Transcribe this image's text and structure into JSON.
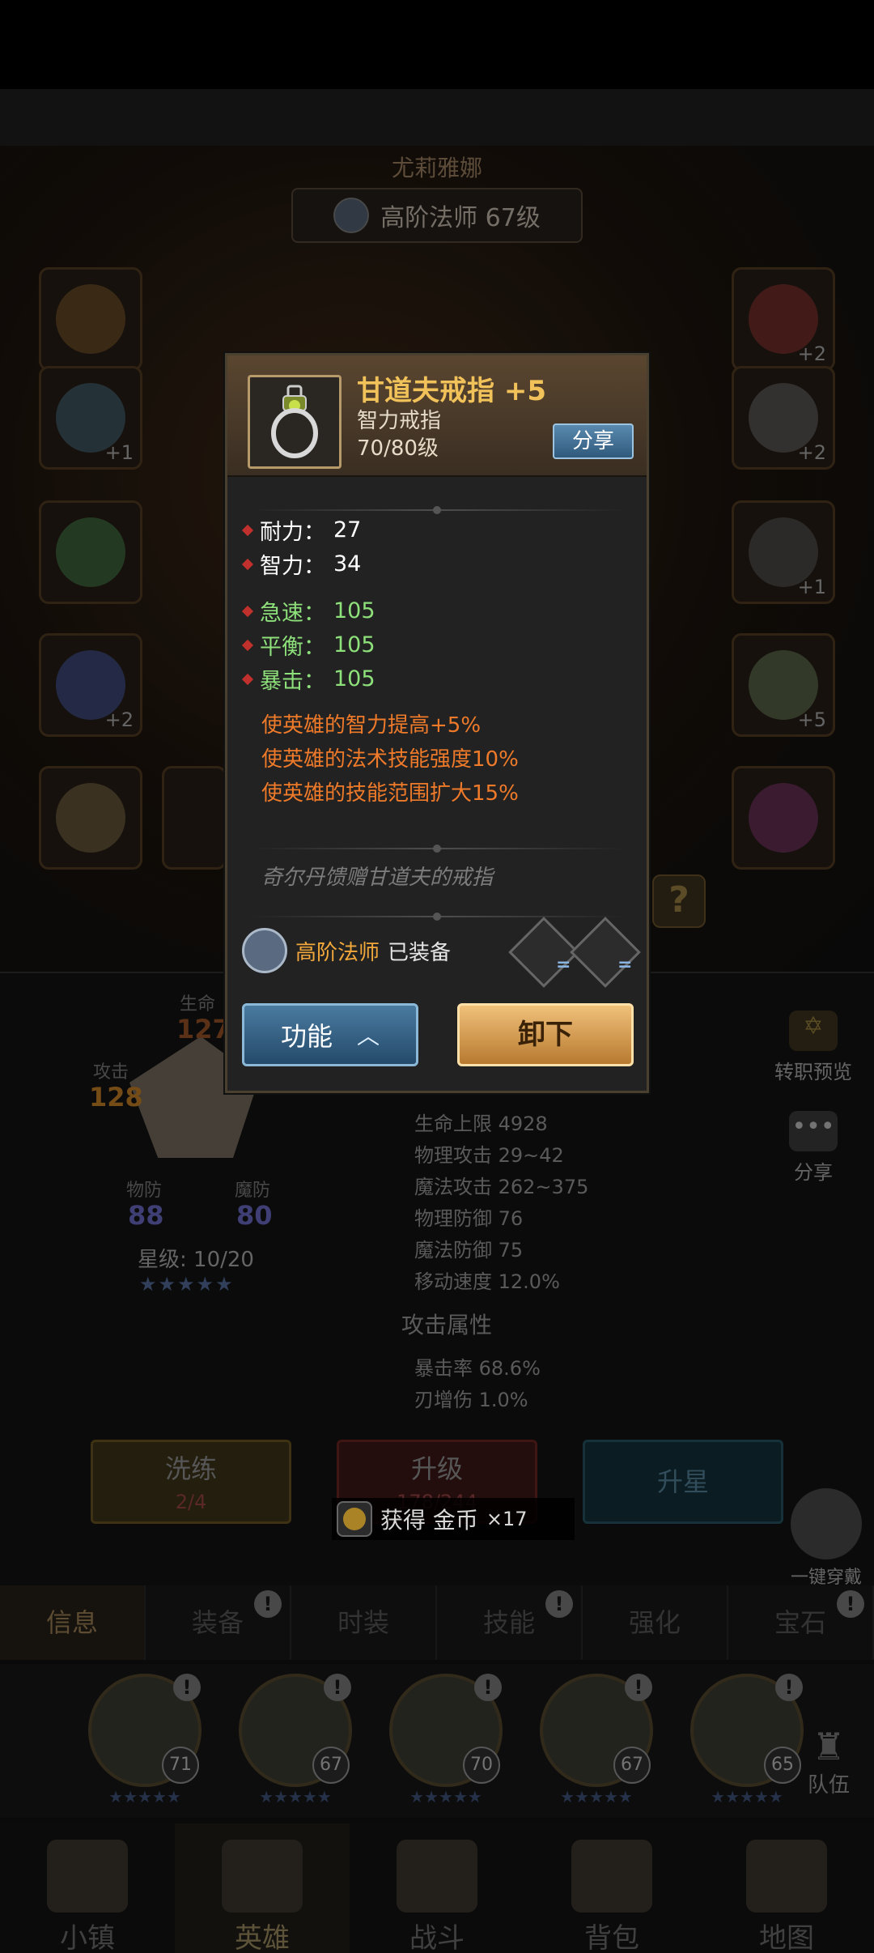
{
  "hero": {
    "name": "尤莉雅娜",
    "class_banner": "高阶法师 67级"
  },
  "equip_slots": [
    {
      "name": "slot-left-1",
      "plus": ""
    },
    {
      "name": "slot-left-2",
      "plus": "+1"
    },
    {
      "name": "slot-left-3",
      "plus": ""
    },
    {
      "name": "slot-left-4",
      "plus": "+2"
    },
    {
      "name": "slot-left-5",
      "plus": ""
    },
    {
      "name": "slot-right-1",
      "plus": "+2"
    },
    {
      "name": "slot-right-2",
      "plus": "+2"
    },
    {
      "name": "slot-right-3",
      "plus": "+1"
    },
    {
      "name": "slot-right-4",
      "plus": "+5"
    },
    {
      "name": "slot-right-5",
      "plus": ""
    }
  ],
  "help_label": "?",
  "tooltip": {
    "title": "甘道夫戒指 +5",
    "type": "智力戒指",
    "level": "70/80级",
    "share_label": "分享",
    "base_attrs": [
      {
        "label": "耐力：",
        "value": "27"
      },
      {
        "label": "智力：",
        "value": "34"
      }
    ],
    "green_attrs": [
      {
        "label": "急速：",
        "value": "105"
      },
      {
        "label": "平衡：",
        "value": "105"
      },
      {
        "label": "暴击：",
        "value": "105"
      }
    ],
    "bonuses": [
      "使英雄的智力提高+5%",
      "使英雄的法术技能强度10%",
      "使英雄的技能范围扩大15%"
    ],
    "flavor": "奇尔丹馈赠甘道夫的戒指",
    "equipped_class": "高阶法师",
    "equipped_status": "已装备",
    "slot_eq_1": "=",
    "slot_eq_2": "=",
    "function_label": "功能",
    "unequip_label": "卸下"
  },
  "radar": {
    "life_label": "生命",
    "life_value": "127",
    "attack_label": "攻击",
    "attack_value": "128",
    "pdef_label": "物防",
    "pdef_value": "88",
    "mdef_label": "魔防",
    "mdef_value": "80"
  },
  "star_level": "星级: 10/20",
  "stars": "★★★★★",
  "stats": [
    "生命上限 4928",
    "物理攻击 29~42",
    "魔法攻击 262~375",
    "物理防御 76",
    "魔法防御 75",
    "移动速度 12.0%"
  ],
  "attack_attr_title": "攻击属性",
  "attack_stats": [
    "暴击率 68.6%",
    "刃增伤 1.0%"
  ],
  "side": {
    "job_preview": "转职预览",
    "share": "分享",
    "share_icon": "•••"
  },
  "buttons": {
    "refine_label": "洗练",
    "refine_count": "2/4",
    "upgrade_label": "升级",
    "upgrade_count": "178/244",
    "star_label": "升星"
  },
  "toast": {
    "text": "获得 金币",
    "count": "×17"
  },
  "onekey_label": "一键穿戴",
  "tabs": [
    {
      "label": "信息",
      "alert": false
    },
    {
      "label": "装备",
      "alert": true
    },
    {
      "label": "时装",
      "alert": false
    },
    {
      "label": "技能",
      "alert": true
    },
    {
      "label": "强化",
      "alert": false
    },
    {
      "label": "宝石",
      "alert": true
    }
  ],
  "alert_mark": "!",
  "heroes": [
    {
      "level": "71",
      "stars": "★★★★★"
    },
    {
      "level": "67",
      "stars": "★★★★★"
    },
    {
      "level": "70",
      "stars": "★★★★★"
    },
    {
      "level": "67",
      "stars": "★★★★★"
    },
    {
      "level": "65",
      "stars": "★★★★★"
    }
  ],
  "team_label": "队伍",
  "nav": [
    {
      "label": "小镇",
      "active": false
    },
    {
      "label": "英雄",
      "active": true
    },
    {
      "label": "战斗",
      "active": false
    },
    {
      "label": "背包",
      "active": false
    },
    {
      "label": "地图",
      "active": false
    }
  ],
  "colors": {
    "title_gold": "#f2c25a",
    "green_attr": "#8de07a",
    "bonus_orange": "#ee7a2a",
    "diamond_red": "#c0302c",
    "attack_radar": "#8a5a1a",
    "life_radar": "#6a3a1a",
    "pdef_radar": "#4a4a8a"
  }
}
